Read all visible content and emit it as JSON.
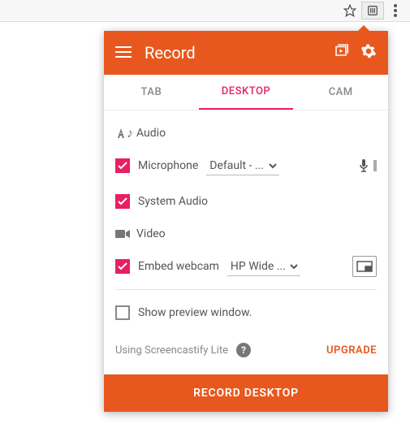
{
  "header": {
    "title": "Record"
  },
  "tabs": {
    "tab": "TAB",
    "desktop": "DESKTOP",
    "cam": "CAM"
  },
  "sections": {
    "audio": "Audio",
    "video": "Video"
  },
  "options": {
    "microphone": {
      "label": "Microphone",
      "selected": "Default - ..."
    },
    "system_audio": {
      "label": "System Audio"
    },
    "embed_webcam": {
      "label": "Embed webcam",
      "selected": "HP Wide ..."
    },
    "show_preview": {
      "label": "Show preview window."
    }
  },
  "footer": {
    "lite": "Using Screencastify Lite",
    "upgrade": "UPGRADE"
  },
  "record_button": "RECORD DESKTOP"
}
